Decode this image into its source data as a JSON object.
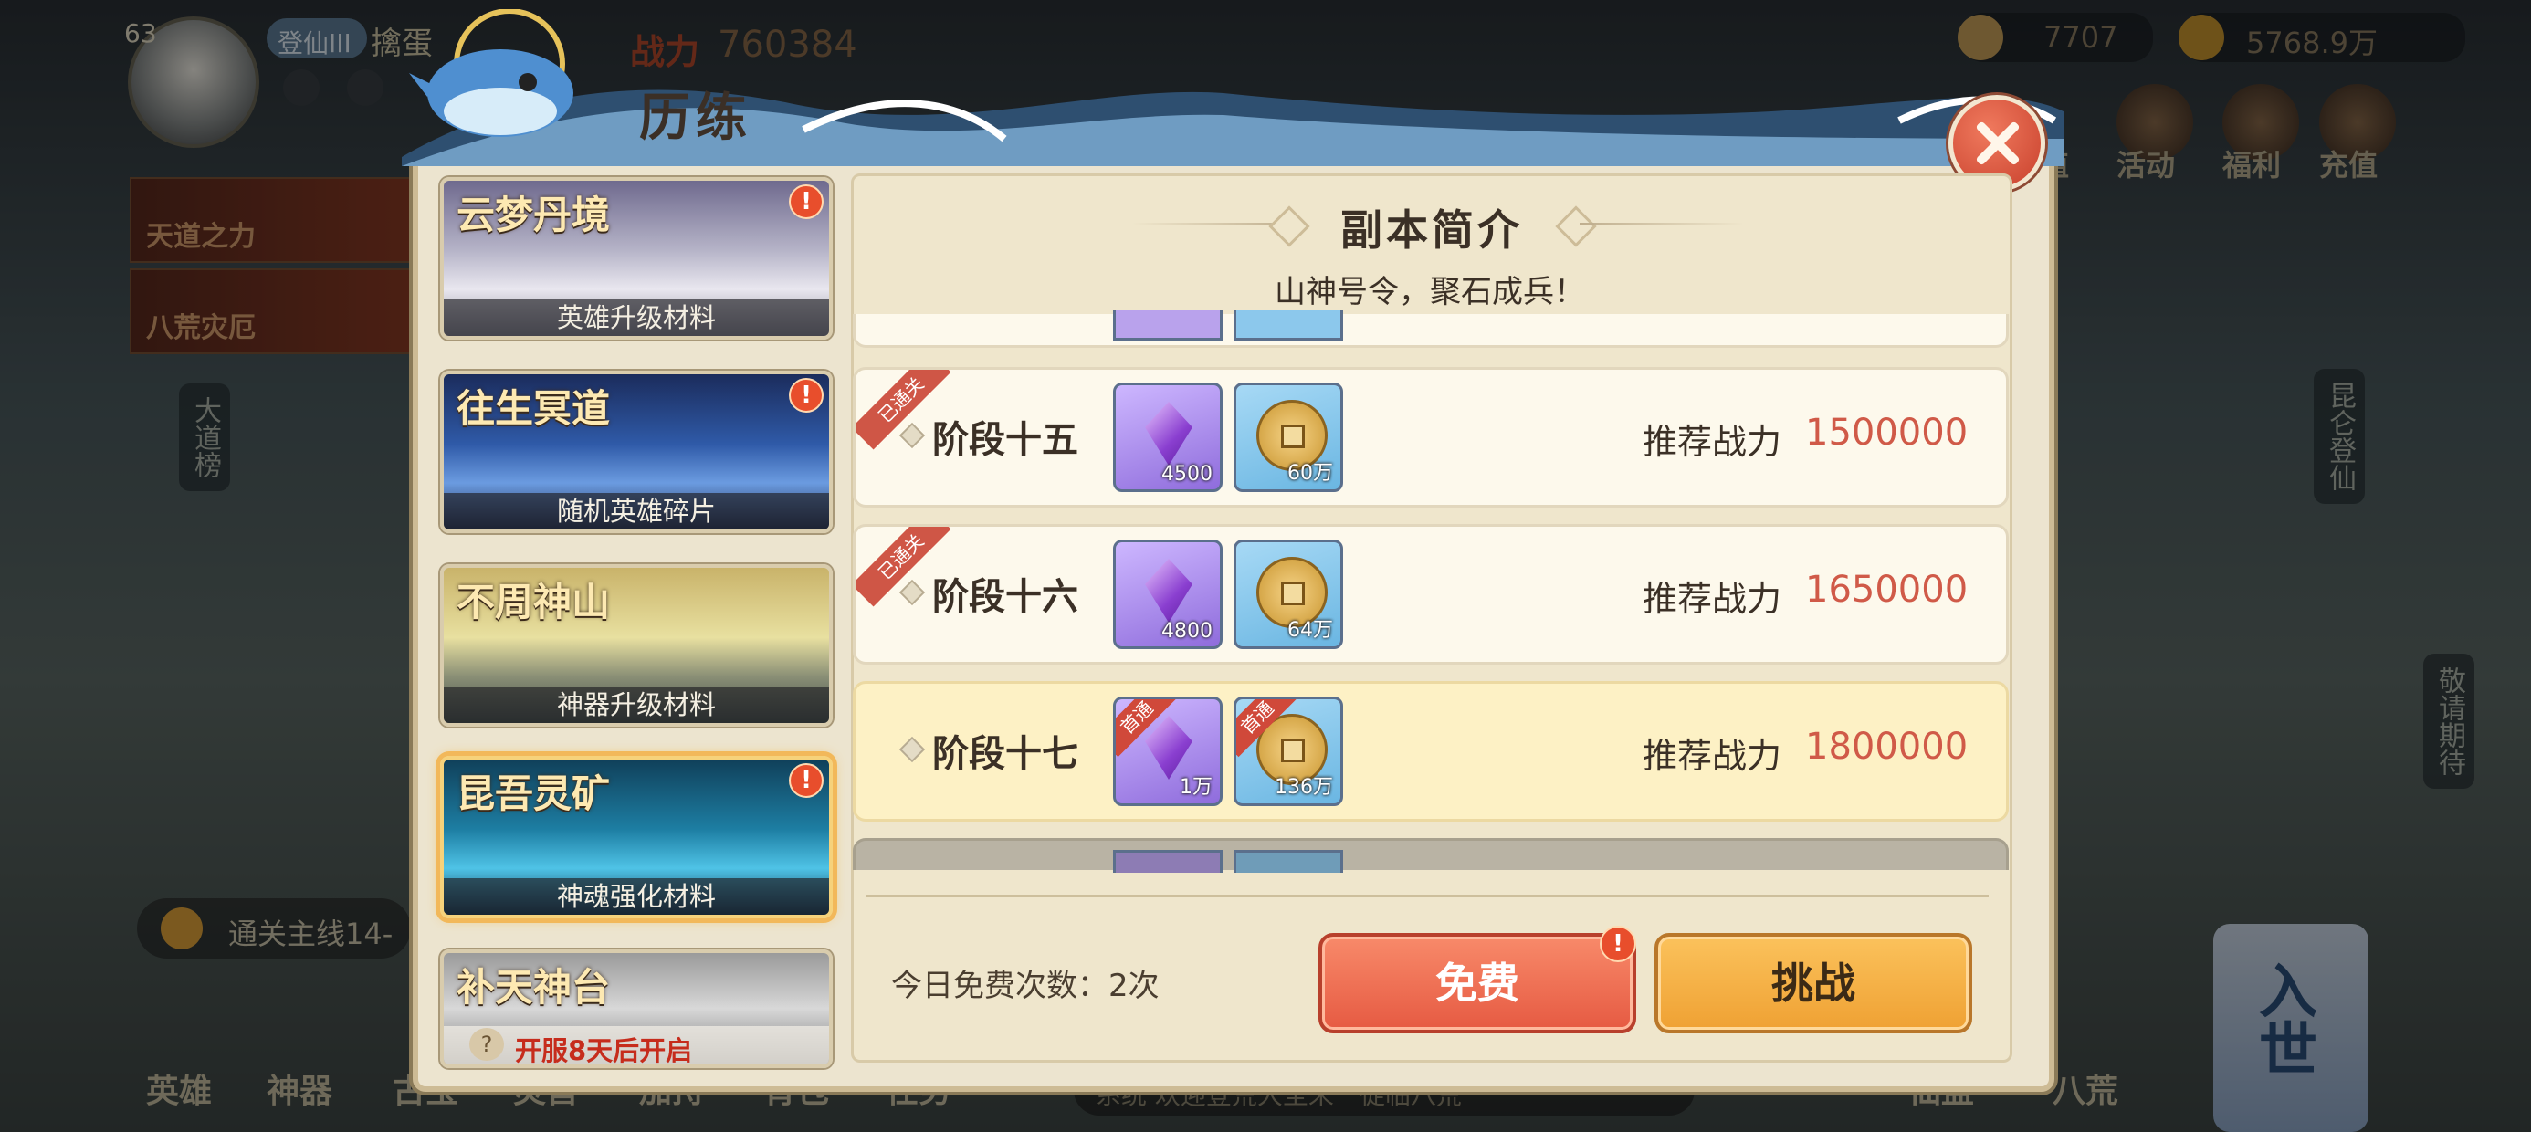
{
  "hud": {
    "level": "63",
    "rank_badge": "登仙III",
    "player_name": "擒蛋",
    "power_prefix": "战力",
    "power": "760384",
    "ingot": "7707",
    "coins": "5768.9万",
    "top_icons": [
      "值",
      "活动",
      "福利",
      "充值"
    ]
  },
  "left_banners": [
    "天道之力",
    "八荒灾厄"
  ],
  "side_labels": {
    "left": "大道榜",
    "right": "昆仑登仙",
    "right2": "敬请期待"
  },
  "quest_text": "通关主线14-",
  "bottom_nav": [
    "英雄",
    "神器",
    "古宝",
    "灵兽",
    "加持",
    "背包",
    "任务"
  ],
  "bottom_right_nav": [
    "仙盟",
    "八荒"
  ],
  "news_text": "系统 欢迎登荒大圣来一徒临八荒",
  "enter_world": "入世",
  "dialog": {
    "title": "历练",
    "section_title": "副本简介",
    "subtitle": "山神号令，聚石成兵！",
    "dungeons": [
      {
        "name": "云梦丹境",
        "desc": "英雄升级材料",
        "alert": "!",
        "locked": false
      },
      {
        "name": "往生冥道",
        "desc": "随机英雄碎片",
        "alert": "!",
        "locked": false
      },
      {
        "name": "不周神山",
        "desc": "神器升级材料",
        "alert": "",
        "locked": false
      },
      {
        "name": "昆吾灵矿",
        "desc": "神魂强化材料",
        "alert": "!",
        "locked": false,
        "selected": true
      },
      {
        "name": "补天神台",
        "desc": "开服8天后开启",
        "alert": "",
        "locked": true
      }
    ],
    "power_label": "推荐战力",
    "cleared_tag": "已通关",
    "first_tag": "首通",
    "stages": [
      {
        "name": "阶段十五",
        "crystal": "4500",
        "coin": "60万",
        "power": "1500000",
        "cleared": true,
        "current": false
      },
      {
        "name": "阶段十六",
        "crystal": "4800",
        "coin": "64万",
        "power": "1650000",
        "cleared": true,
        "current": false
      },
      {
        "name": "阶段十七",
        "crystal": "1万",
        "coin": "136万",
        "power": "1800000",
        "cleared": false,
        "current": true
      }
    ],
    "free_count_label": "今日免费次数：2次",
    "free_button": "免费",
    "free_alert": "!",
    "challenge_button": "挑战"
  }
}
